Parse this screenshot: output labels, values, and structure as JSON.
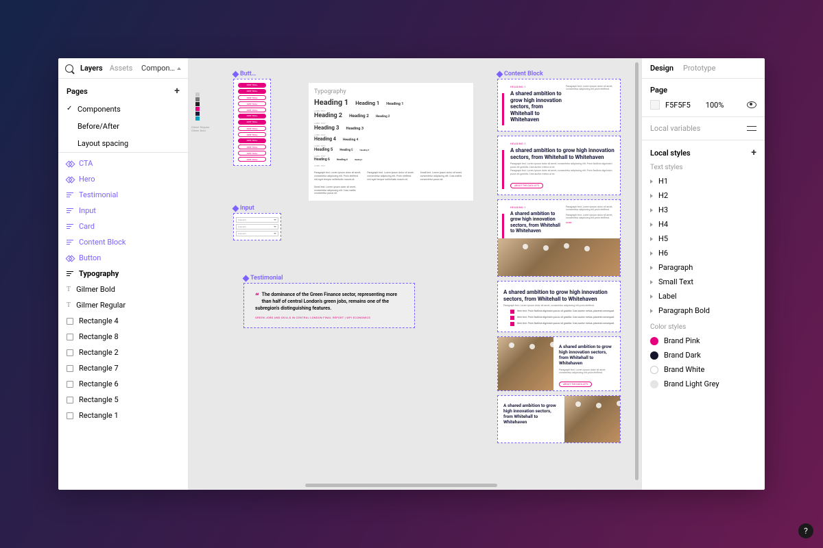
{
  "leftPanel": {
    "tabs": {
      "layers": "Layers",
      "assets": "Assets"
    },
    "pageSelector": "Compon…",
    "pagesHeader": "Pages",
    "pages": [
      {
        "name": "Components",
        "selected": true
      },
      {
        "name": "Before/After",
        "selected": false
      },
      {
        "name": "Layout spacing",
        "selected": false
      }
    ],
    "layers": [
      {
        "name": "CTA",
        "type": "comp",
        "purple": true
      },
      {
        "name": "Hero",
        "type": "comp",
        "purple": true
      },
      {
        "name": "Testimonial",
        "type": "lines",
        "purple": true
      },
      {
        "name": "Input",
        "type": "lines",
        "purple": true
      },
      {
        "name": "Card",
        "type": "lines",
        "purple": true
      },
      {
        "name": "Content Block",
        "type": "lines",
        "purple": true
      },
      {
        "name": "Button",
        "type": "comp",
        "purple": true
      },
      {
        "name": "Typography",
        "type": "lines",
        "bold": true
      },
      {
        "name": "Gilmer Bold",
        "type": "text"
      },
      {
        "name": "Gilmer Regular",
        "type": "text"
      },
      {
        "name": "Rectangle 4",
        "type": "rect"
      },
      {
        "name": "Rectangle 8",
        "type": "rect"
      },
      {
        "name": "Rectangle 2",
        "type": "rect"
      },
      {
        "name": "Rectangle 7",
        "type": "rect"
      },
      {
        "name": "Rectangle 6",
        "type": "rect"
      },
      {
        "name": "Rectangle 5",
        "type": "rect"
      },
      {
        "name": "Rectangle 1",
        "type": "rect"
      }
    ]
  },
  "canvas": {
    "frameLabels": {
      "buttons": "Butt…",
      "input": "Input",
      "testimonial": "Testimonial",
      "contentBlock": "Content Block"
    },
    "swatches": [
      "#cccccc",
      "#777777",
      "#222222",
      "#e6007e",
      "#1a1a3a",
      "#00a0c0"
    ],
    "swatchLabel": "Gilmer Regular\nGilmer Bold",
    "buttonLabel": "FREE TRIAL",
    "typography": {
      "title": "Typography",
      "rows": [
        {
          "c1": "Heading 1",
          "c2": "Heading 1",
          "c3": "Heading 1",
          "s1": 11,
          "lbl": "LABEL TEXT"
        },
        {
          "c1": "Heading 2",
          "c2": "Heading 2",
          "c3": "Heading 2",
          "s1": 9,
          "lbl": "LABEL TEXT"
        },
        {
          "c1": "Heading 3",
          "c2": "Heading 3",
          "c3": "",
          "s1": 8,
          "lbl": "LABEL TEXT"
        },
        {
          "c1": "Heading 4",
          "c2": "Heading 4",
          "c3": "",
          "s1": 7,
          "lbl": "LABEL TEXT"
        },
        {
          "c1": "Heading 5",
          "c2": "Heading 5",
          "c3": "Heading 5",
          "s1": 6,
          "lbl": "LABEL TEXT"
        },
        {
          "c1": "Heading 6",
          "c2": "Heading 6",
          "c3": "Heading 6",
          "s1": 5,
          "lbl": "LABEL TEXT"
        }
      ],
      "para": "Paragraph text. Lorem ipsum dolor sit amet, consectetur adipiscing elit. Proin eleifend nisl eget tempor sollicitudin mauris at.",
      "small": "Small text. Lorem ipsum dolor sit amet, consectetur adipiscing elit. Cras mattis consectetur purus sit."
    },
    "input": {
      "placeholder": "Free text"
    },
    "testimonial": {
      "quote": "The dominance of the Green Finance sector, representing more than half of central London's green jobs, remains one of the subregion's distinguishing features.",
      "source": "GREEN JOBS AND SKILLS IN CENTRAL LONDON FINAL REPORT | WPI ECONOMICS"
    },
    "contentBlocks": {
      "overline": "HEADING 1",
      "heading": "A shared ambition to grow high innovation sectors, from Whitehall to Whitehaven",
      "headingShort": "A shared ambition to grow high innovation sectors, from Whitehall to Whitehaven",
      "body": "Paragraph text. Lorem ipsum dolor sit amet, consectetur adipiscing elit proin eleifend.",
      "bodyLong": "Paragraph text. Lorem ipsum dolor sit amet, consectetur adipiscing elit. Proin facilisis dignissim purus sit gravida. Cras auctor metus ut ex.",
      "cta": "ABOUT THE DATA CITY",
      "listItem": "Item text. Proin facilisis dignissim purus sit gravida. Cras auctor metus, placerat consequat.",
      "more": "MORE"
    }
  },
  "rightPanel": {
    "tabs": {
      "design": "Design",
      "prototype": "Prototype"
    },
    "pageSection": {
      "title": "Page",
      "color": "F5F5F5",
      "opacity": "100%"
    },
    "localVariables": "Local variables",
    "localStyles": "Local styles",
    "textStylesHeader": "Text styles",
    "textStyles": [
      "H1",
      "H2",
      "H3",
      "H4",
      "H5",
      "H6",
      "Paragraph",
      "Small Text",
      "Label",
      "Paragraph Bold"
    ],
    "colorStylesHeader": "Color styles",
    "colorStyles": [
      {
        "name": "Brand Pink",
        "hex": "#e6007e"
      },
      {
        "name": "Brand Dark",
        "hex": "#14142b"
      },
      {
        "name": "Brand White",
        "hex": "#ffffff",
        "border": true
      },
      {
        "name": "Brand Light Grey",
        "hex": "#e5e5e5"
      }
    ],
    "help": "?"
  }
}
